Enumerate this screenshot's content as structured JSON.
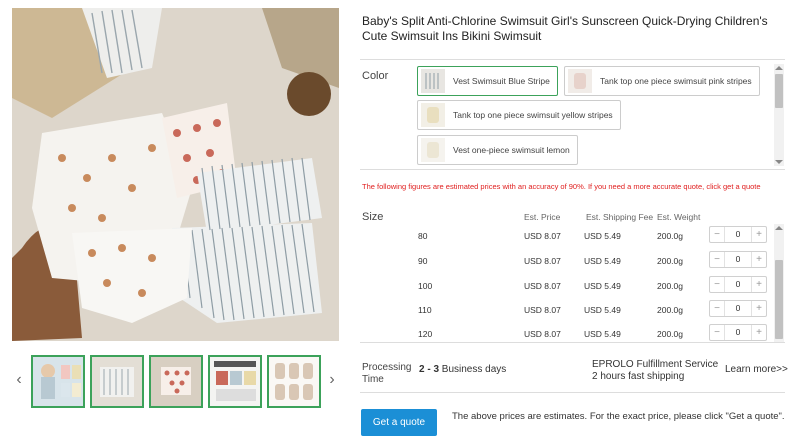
{
  "product": {
    "title": "Baby's Split Anti-Chlorine Swimsuit Girl's Sunscreen Quick-Drying Children's Cute Swimsuit Ins Bikini Swimsuit"
  },
  "gallery": {
    "main_image_icon": "product-photo",
    "prev_icon": "‹",
    "next_icon": "›",
    "thumbnails": [
      {
        "name": "thumb-1"
      },
      {
        "name": "thumb-2"
      },
      {
        "name": "thumb-3"
      },
      {
        "name": "thumb-4"
      },
      {
        "name": "thumb-5"
      }
    ]
  },
  "color": {
    "label": "Color",
    "selected": "Vest Swimsuit Blue Stripe",
    "options": [
      {
        "label": "Vest Swimsuit Blue Stripe"
      },
      {
        "label": "Tank top one piece swimsuit pink stripes"
      },
      {
        "label": "Tank top one piece swimsuit yellow stripes"
      },
      {
        "label": "Vest one-piece swimsuit lemon"
      }
    ]
  },
  "notice": "The following figures are estimated prices with an accuracy of 90%. If you need a more accurate quote, click get a quote",
  "sizes": {
    "label": "Size",
    "headers": {
      "price": "Est. Price",
      "shipping": "Est. Shipping Fee",
      "weight": "Est. Weight"
    },
    "rows": [
      {
        "size": "80",
        "price": "USD 8.07",
        "shipping": "USD 5.49",
        "weight": "200.0g",
        "qty": "0"
      },
      {
        "size": "90",
        "price": "USD 8.07",
        "shipping": "USD 5.49",
        "weight": "200.0g",
        "qty": "0"
      },
      {
        "size": "100",
        "price": "USD 8.07",
        "shipping": "USD 5.49",
        "weight": "200.0g",
        "qty": "0"
      },
      {
        "size": "110",
        "price": "USD 8.07",
        "shipping": "USD 5.49",
        "weight": "200.0g",
        "qty": "0"
      },
      {
        "size": "120",
        "price": "USD 8.07",
        "shipping": "USD 5.49",
        "weight": "200.0g",
        "qty": "0"
      }
    ],
    "minus": "−",
    "plus": "+"
  },
  "processing": {
    "label": "Processing Time",
    "value_bold": "2 - 3",
    "value_rest": " Business days",
    "service_line1": "EPROLO Fulfillment Service",
    "service_line2": "2 hours fast shipping",
    "learn_more": "Learn more>>"
  },
  "actions": {
    "get_quote": "Get a quote",
    "note": "The above prices are estimates. For the exact price, please click \"Get a quote\"."
  },
  "colors": {
    "accent": "#3ca25a",
    "button": "#1b8fd6",
    "warning": "#e02020"
  }
}
